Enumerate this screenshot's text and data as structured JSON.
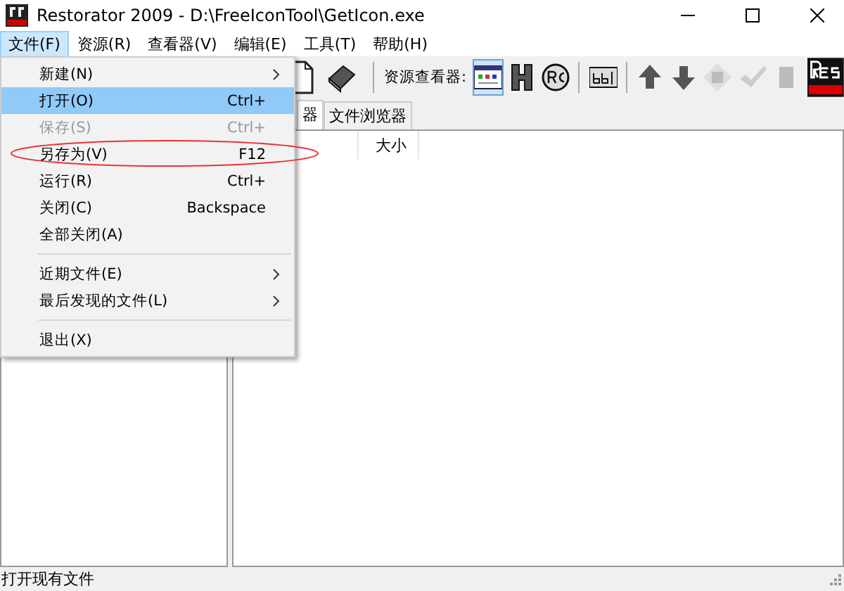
{
  "window": {
    "title": "Restorator 2009 - D:\\FreeIconTool\\GetIcon.exe"
  },
  "menu_bar": [
    {
      "label": "文件(F)",
      "selected": true
    },
    {
      "label": "资源(R)",
      "selected": false
    },
    {
      "label": "查看器(V)",
      "selected": false
    },
    {
      "label": "编辑(E)",
      "selected": false
    },
    {
      "label": "工具(T)",
      "selected": false
    },
    {
      "label": "帮助(H)",
      "selected": false
    }
  ],
  "file_menu": [
    {
      "kind": "item",
      "label": "新建(N)",
      "submenu": true,
      "selected": false,
      "disabled": false
    },
    {
      "kind": "item",
      "label": "打开(O)",
      "shortcut": "Ctrl+",
      "submenu": false,
      "selected": true,
      "disabled": false
    },
    {
      "kind": "item",
      "label": "保存(S)",
      "shortcut": "Ctrl+",
      "submenu": false,
      "selected": false,
      "disabled": true
    },
    {
      "kind": "item",
      "label": "另存为(V)",
      "shortcut": "F12",
      "submenu": false,
      "selected": false,
      "disabled": false,
      "circled": true
    },
    {
      "kind": "item",
      "label": "运行(R)",
      "shortcut": "Ctrl+",
      "submenu": false,
      "selected": false,
      "disabled": false
    },
    {
      "kind": "item",
      "label": "关闭(C)",
      "shortcut": "Backspace",
      "submenu": false,
      "selected": false,
      "disabled": false
    },
    {
      "kind": "item",
      "label": "全部关闭(A)",
      "submenu": false,
      "selected": false,
      "disabled": false
    },
    {
      "kind": "separator"
    },
    {
      "kind": "item",
      "label": "近期文件(E)",
      "submenu": true,
      "selected": false,
      "disabled": false
    },
    {
      "kind": "item",
      "label": "最后发现的文件(L)",
      "submenu": true,
      "selected": false,
      "disabled": false
    },
    {
      "kind": "separator"
    },
    {
      "kind": "item",
      "label": "退出(X)",
      "submenu": false,
      "selected": false,
      "disabled": false
    }
  ],
  "toolbar": {
    "viewer_label": "资源查看器:",
    "buttons": [
      {
        "kind": "viewer",
        "selected": true
      },
      {
        "kind": "header",
        "selected": false
      },
      {
        "kind": "rc",
        "selected": false
      },
      {
        "kind": "sep"
      },
      {
        "kind": "text",
        "selected": false
      },
      {
        "kind": "sep"
      },
      {
        "kind": "up",
        "selected": false,
        "disabled": false
      },
      {
        "kind": "down",
        "selected": false,
        "disabled": false
      },
      {
        "kind": "diamond",
        "selected": false,
        "disabled": true
      },
      {
        "kind": "check",
        "selected": false,
        "disabled": true
      },
      {
        "kind": "blank",
        "selected": false,
        "disabled": true
      }
    ]
  },
  "tabs": [
    {
      "label": "器",
      "selected": true
    },
    {
      "label": "文件浏览器",
      "selected": false
    }
  ],
  "table": {
    "columns": [
      "大小"
    ]
  },
  "status_bar": {
    "text": "打开现有文件"
  }
}
